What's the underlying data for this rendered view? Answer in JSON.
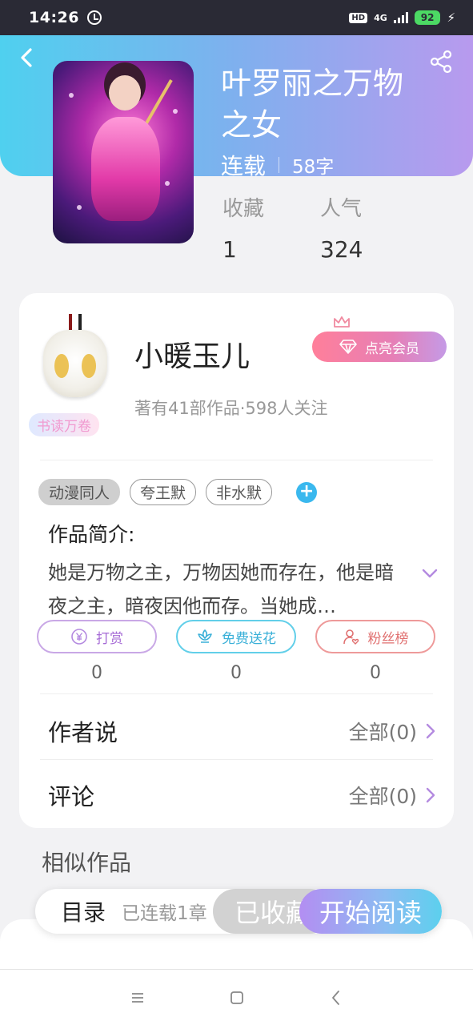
{
  "status_bar": {
    "time": "14:26",
    "hd": "HD",
    "network": "4G",
    "battery": "92"
  },
  "book": {
    "title": "叶罗丽之万物之女",
    "status": "连载",
    "word_count": "58字",
    "stats": [
      {
        "label": "收藏",
        "value": "1"
      },
      {
        "label": "人气",
        "value": "324"
      }
    ]
  },
  "author": {
    "name": "小暖玉儿",
    "info": "著有41部作品·598人关注",
    "badge": "书读万卷",
    "vip_button": "点亮会员"
  },
  "tags": [
    "动漫同人",
    "夸王默",
    "非水默"
  ],
  "add_tag": "+",
  "intro": {
    "title": "作品简介:",
    "text": "她是万物之主，万物因她而存在，他是暗夜之主，暗夜因他而存。当她成…"
  },
  "actions": [
    {
      "label": "打赏",
      "count": "0"
    },
    {
      "label": "免费送花",
      "count": "0"
    },
    {
      "label": "粉丝榜",
      "count": "0"
    }
  ],
  "author_says": {
    "label": "作者说",
    "link": "全部(0)"
  },
  "comments": {
    "label": "评论",
    "link": "全部(0)"
  },
  "similar": "相似作品",
  "bottom": {
    "toc": "目录",
    "toc_status": "已连载1章",
    "favorited": "已收藏",
    "start_reading": "开始阅读"
  },
  "colors": {
    "header_start": "#4fd0ef",
    "header_end": "#b89aee",
    "vip_start": "#ff7f9a",
    "accent_blue": "#3ab8ee"
  }
}
